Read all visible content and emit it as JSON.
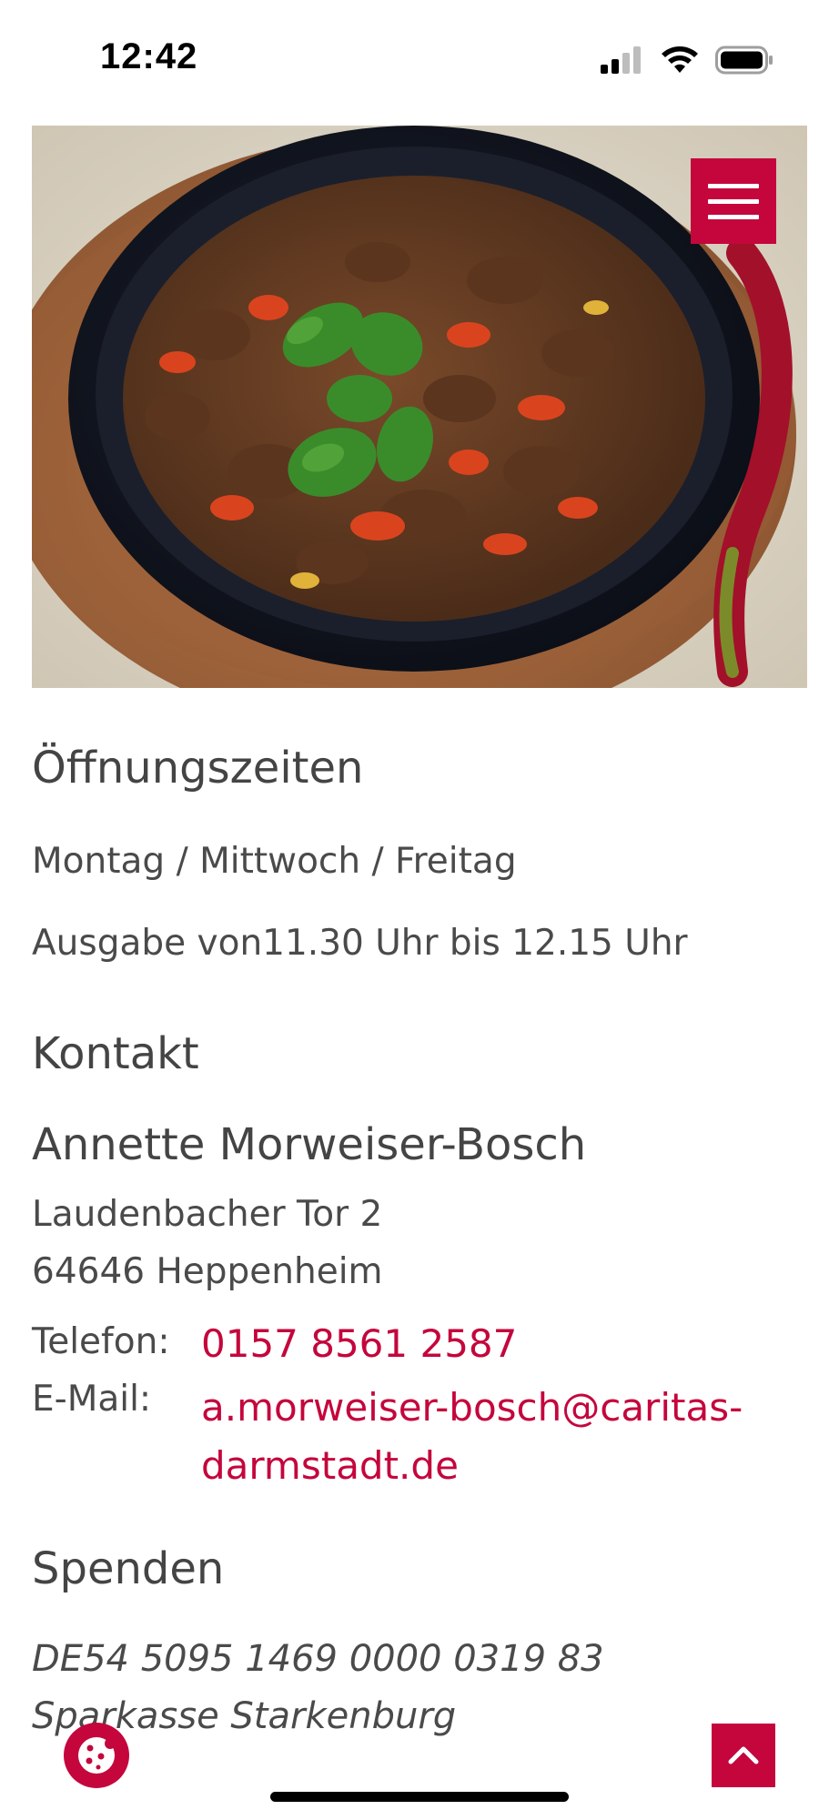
{
  "status_bar": {
    "time": "12:42",
    "icons": [
      "cellular-signal-icon",
      "wifi-icon",
      "battery-icon"
    ]
  },
  "hero": {
    "image": "food-dish-photo",
    "menu_icon": "hamburger-menu-icon"
  },
  "opening": {
    "title": "Öffnungszeiten",
    "days": "Montag / Mittwoch / Freitag",
    "time": "Ausgabe von11.30 Uhr bis 12.15 Uhr"
  },
  "contact": {
    "title": "Kontakt",
    "name": "Annette Morweiser-Bosch",
    "street": "Laudenbacher Tor 2",
    "city": "64646 Heppenheim",
    "phone_label": "Telefon:",
    "phone": "0157 8561 2587",
    "email_label": "E-Mail:",
    "email": "a.morweiser-bosch@caritas-darmstadt.de"
  },
  "donations": {
    "title": "Spenden",
    "iban": "DE54 5095 1469 0000 0319 83",
    "bank": "Sparkasse Starkenburg"
  },
  "floating": {
    "cookie_icon": "cookie-icon",
    "scroll_top_icon": "chevron-up-icon"
  },
  "colors": {
    "accent": "#c4063c",
    "text": "#4a4a4a"
  }
}
